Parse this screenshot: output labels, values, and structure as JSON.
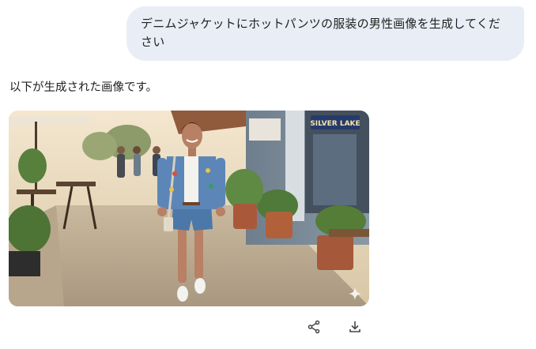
{
  "conversation": {
    "user_prompt": "デニムジャケットにホットパンツの服装の男性画像を生成してください",
    "assistant_reply": "以下が生成された画像です。"
  },
  "generated_image": {
    "storefront_sign": "SILVER LAKE"
  },
  "actions": {
    "share_icon": "share-icon",
    "download_icon": "download-icon"
  },
  "colors": {
    "bubble_background": "#e9eef6",
    "icon_color": "#444746"
  }
}
